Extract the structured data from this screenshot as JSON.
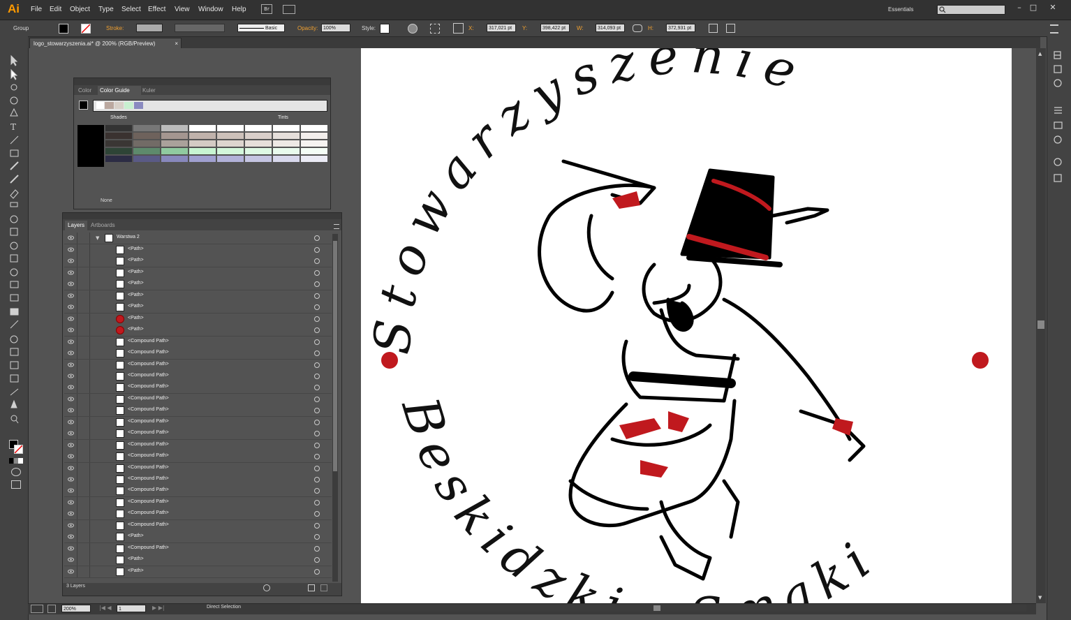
{
  "app": {
    "logo": "Ai"
  },
  "menubar": {
    "items": [
      "File",
      "Edit",
      "Object",
      "Type",
      "Select",
      "Effect",
      "View",
      "Window",
      "Help"
    ],
    "bridge": "Br",
    "workspace": "Essentials"
  },
  "control": {
    "selection": "Group",
    "stroke_label": "Stroke:",
    "brush": "Basic",
    "opacity_label": "Opacity:",
    "opacity": "100%",
    "style_label": "Style:",
    "x_label": "X:",
    "x": "317,021 pt",
    "y_label": "Y:",
    "y": "398,422 pt",
    "w_label": "W:",
    "w": "314,093 pt",
    "h_label": "H:",
    "h": "372,931 pt"
  },
  "document": {
    "tab": "logo_stowarzyszenia.ai* @ 200% (RGB/Preview)"
  },
  "color_panel": {
    "tabs": [
      "Color",
      "Color Guide",
      "Kuler"
    ],
    "shades": "Shades",
    "tints": "Tints",
    "none": "None"
  },
  "layers_panel": {
    "tabs": [
      "Layers",
      "Artboards"
    ],
    "layer_name": "Warstwa 2",
    "rows": [
      {
        "name": "<Path>",
        "thumb": "white"
      },
      {
        "name": "<Path>",
        "thumb": "white"
      },
      {
        "name": "<Path>",
        "thumb": "white"
      },
      {
        "name": "<Path>",
        "thumb": "white"
      },
      {
        "name": "<Path>",
        "thumb": "white"
      },
      {
        "name": "<Path>",
        "thumb": "white"
      },
      {
        "name": "<Path>",
        "thumb": "red"
      },
      {
        "name": "<Path>",
        "thumb": "red"
      },
      {
        "name": "<Compound Path>",
        "thumb": "white"
      },
      {
        "name": "<Compound Path>",
        "thumb": "white"
      },
      {
        "name": "<Compound Path>",
        "thumb": "white"
      },
      {
        "name": "<Compound Path>",
        "thumb": "white"
      },
      {
        "name": "<Compound Path>",
        "thumb": "white"
      },
      {
        "name": "<Compound Path>",
        "thumb": "white"
      },
      {
        "name": "<Compound Path>",
        "thumb": "white"
      },
      {
        "name": "<Compound Path>",
        "thumb": "white"
      },
      {
        "name": "<Compound Path>",
        "thumb": "white"
      },
      {
        "name": "<Compound Path>",
        "thumb": "white"
      },
      {
        "name": "<Compound Path>",
        "thumb": "white"
      },
      {
        "name": "<Compound Path>",
        "thumb": "white"
      },
      {
        "name": "<Compound Path>",
        "thumb": "white"
      },
      {
        "name": "<Compound Path>",
        "thumb": "white"
      },
      {
        "name": "<Compound Path>",
        "thumb": "white"
      },
      {
        "name": "<Compound Path>",
        "thumb": "white"
      },
      {
        "name": "<Compound Path>",
        "thumb": "white"
      },
      {
        "name": "<Path>",
        "thumb": "white"
      },
      {
        "name": "<Compound Path>",
        "thumb": "white"
      },
      {
        "name": "<Path>",
        "thumb": "white"
      },
      {
        "name": "<Path>",
        "thumb": "white"
      }
    ],
    "footer": "3 Layers"
  },
  "artwork": {
    "top_text": "Stowarzyszenie",
    "bottom_text": "Beskidzkie Smaki"
  },
  "statusbar": {
    "zoom": "200%",
    "artboard": "1",
    "tool": "Direct Selection"
  },
  "colors": {
    "accent": "#ff9a00",
    "red": "#c0191e"
  }
}
